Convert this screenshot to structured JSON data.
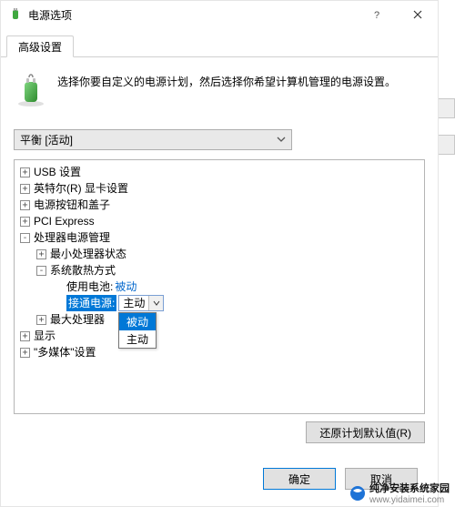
{
  "window": {
    "title": "电源选项"
  },
  "tabs": {
    "advanced": "高级设置"
  },
  "description": "选择你要自定义的电源计划，然后选择你希望计算机管理的电源设置。",
  "plan_selected": "平衡 [活动]",
  "tree": {
    "usb": "USB 设置",
    "intel_gfx": "英特尔(R) 显卡设置",
    "power_buttons": "电源按钮和盖子",
    "pci": "PCI Express",
    "cpu_pm": "处理器电源管理",
    "cpu_min": "最小处理器状态",
    "cooling": "系统散热方式",
    "on_battery_label": "使用电池:",
    "on_battery_value": "被动",
    "plugged_in_label": "接通电源:",
    "plugged_in_value": "主动",
    "cpu_max": "最大处理器",
    "display": "显示",
    "multimedia": "\"多媒体\"设置"
  },
  "dropdown": {
    "opt_passive": "被动",
    "opt_active": "主动"
  },
  "buttons": {
    "restore": "还原计划默认值(R)",
    "ok": "确定",
    "cancel": "取消"
  },
  "watermark": {
    "title": "纯净安装系统家园",
    "url": "www.yidaimei.com"
  }
}
